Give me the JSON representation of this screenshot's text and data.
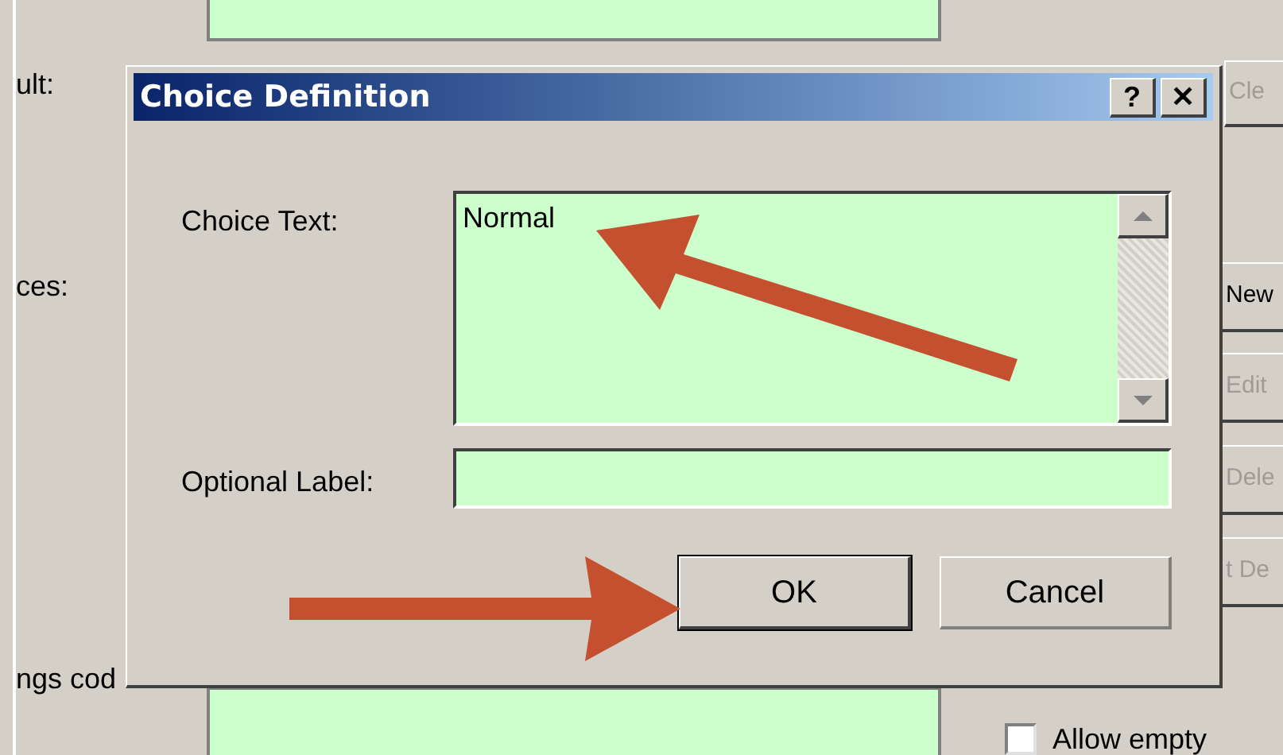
{
  "background_window": {
    "labels": [
      {
        "text": "ult:"
      },
      {
        "text": "ces:"
      },
      {
        "text": "ngs cod"
      }
    ],
    "buttons": [
      {
        "label": "Cle",
        "disabled": true
      },
      {
        "label": "New",
        "disabled": false
      },
      {
        "label": "Edit",
        "disabled": true
      },
      {
        "label": "Dele",
        "disabled": true
      },
      {
        "label": "t De",
        "disabled": true
      }
    ],
    "checkbox": {
      "label": "Allow empty",
      "checked": false
    }
  },
  "dialog": {
    "title": "Choice Definition",
    "title_buttons": [
      "?",
      "✕"
    ],
    "fields": [
      {
        "kind": "textarea",
        "label": "Choice Text:",
        "value": "Normal"
      },
      {
        "kind": "input",
        "label": "Optional Label:"
      }
    ],
    "buttons": [
      {
        "label": "OK",
        "default": true
      },
      {
        "label": "Cancel",
        "default": false
      }
    ]
  }
}
